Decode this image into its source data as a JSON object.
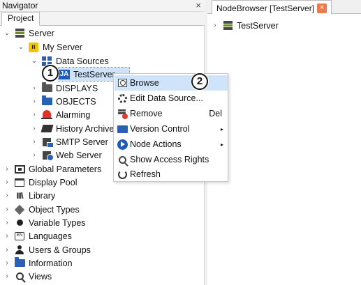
{
  "navigator": {
    "title": "Navigator",
    "close_glyph": "×",
    "tab": "Project"
  },
  "tree": [
    {
      "label": "Server",
      "chevron": "⌄",
      "icon": "server-icon"
    },
    {
      "label": "My Server",
      "chevron": "⌄",
      "icon": "my-server-icon"
    },
    {
      "label": "Data Sources",
      "chevron": "⌄",
      "icon": "data-sources-icon"
    },
    {
      "label": "TestServer",
      "chevron": "",
      "icon": "ja-icon",
      "icon_text": "JA"
    },
    {
      "label": "DISPLAYS",
      "chevron": "›",
      "icon": "folder-icon"
    },
    {
      "label": "OBJECTS",
      "chevron": "›",
      "icon": "folder-icon"
    },
    {
      "label": "Alarming",
      "chevron": "›",
      "icon": "bell-icon"
    },
    {
      "label": "History Archive",
      "chevron": "›",
      "icon": "book-icon"
    },
    {
      "label": "SMTP Server",
      "chevron": "›",
      "icon": "mail-server-icon"
    },
    {
      "label": "Web Server",
      "chevron": "›",
      "icon": "web-server-icon"
    },
    {
      "label": "Global Parameters",
      "chevron": "›",
      "icon": "parameters-icon"
    },
    {
      "label": "Display Pool",
      "chevron": "›",
      "icon": "display-pool-icon"
    },
    {
      "label": "Library",
      "chevron": "›",
      "icon": "library-icon",
      "icon_text": "III\\"
    },
    {
      "label": "Object Types",
      "chevron": "›",
      "icon": "cube-icon"
    },
    {
      "label": "Variable Types",
      "chevron": "›",
      "icon": "dot-icon"
    },
    {
      "label": "Languages",
      "chevron": "›",
      "icon": "languages-icon",
      "icon_text": "EN"
    },
    {
      "label": "Users & Groups",
      "chevron": "›",
      "icon": "user-icon"
    },
    {
      "label": "Information",
      "chevron": "›",
      "icon": "folder-icon"
    },
    {
      "label": "Views",
      "chevron": "›",
      "icon": "search-icon"
    }
  ],
  "badges": {
    "step1": "1",
    "step2": "2"
  },
  "context_menu": [
    {
      "label": "Browse",
      "shortcut": "",
      "submenu": false,
      "highlighted": true,
      "icon": "browse-icon"
    },
    {
      "label": "Edit Data Source...",
      "shortcut": "",
      "submenu": false,
      "highlighted": false,
      "icon": "gear-icon"
    },
    {
      "label": "Remove",
      "shortcut": "Del",
      "submenu": false,
      "highlighted": false,
      "icon": "remove-icon"
    },
    {
      "label": "Version Control",
      "shortcut": "",
      "submenu": true,
      "highlighted": false,
      "icon": "folder-icon"
    },
    {
      "label": "Node Actions",
      "shortcut": "",
      "submenu": true,
      "highlighted": false,
      "icon": "play-icon"
    },
    {
      "label": "Show Access Rights",
      "shortcut": "",
      "submenu": false,
      "highlighted": false,
      "icon": "magnifier-icon"
    },
    {
      "label": "Refresh",
      "shortcut": "",
      "submenu": false,
      "highlighted": false,
      "icon": "refresh-icon"
    }
  ],
  "submenu_arrow": "▸",
  "node_browser": {
    "tab": "NodeBrowser [TestServer]",
    "close_glyph": "×",
    "root": {
      "label": "TestServer",
      "chevron": "›"
    }
  },
  "colors": {
    "selection": "#cfe4fa",
    "folder_blue": "#2b5fb4",
    "tab_close": "#ee7a4b"
  }
}
